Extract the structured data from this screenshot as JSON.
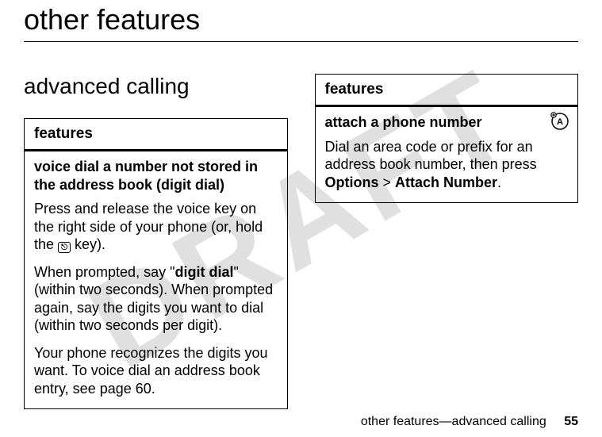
{
  "watermark": "DRAFT",
  "chapter_title": "other features",
  "section_title": "advanced calling",
  "box_left": {
    "header": "features",
    "feature_title": "voice dial a number not stored in the address book (digit dial)",
    "p1a": "Press and release the voice key on the right side of your phone (or, hold the ",
    "key_glyph": "⎋",
    "p1b": " key).",
    "p2a": "When prompted, say \"",
    "p2_bold": "digit dial",
    "p2b": "\" (within two seconds). When prompted again, say the digits you want to dial (within two seconds per digit).",
    "p3": "Your phone recognizes the digits you want. To voice dial an address book entry, see page 60."
  },
  "box_right": {
    "header": "features",
    "feature_title": "attach a phone number",
    "p1a": "Dial an area code or prefix for an address book number, then press ",
    "p1_bold1": "Options",
    "p1_gt": " > ",
    "p1_bold2": "Attach Number",
    "p1_end": "."
  },
  "footer": {
    "breadcrumb": "other features—advanced calling",
    "page": "55"
  }
}
